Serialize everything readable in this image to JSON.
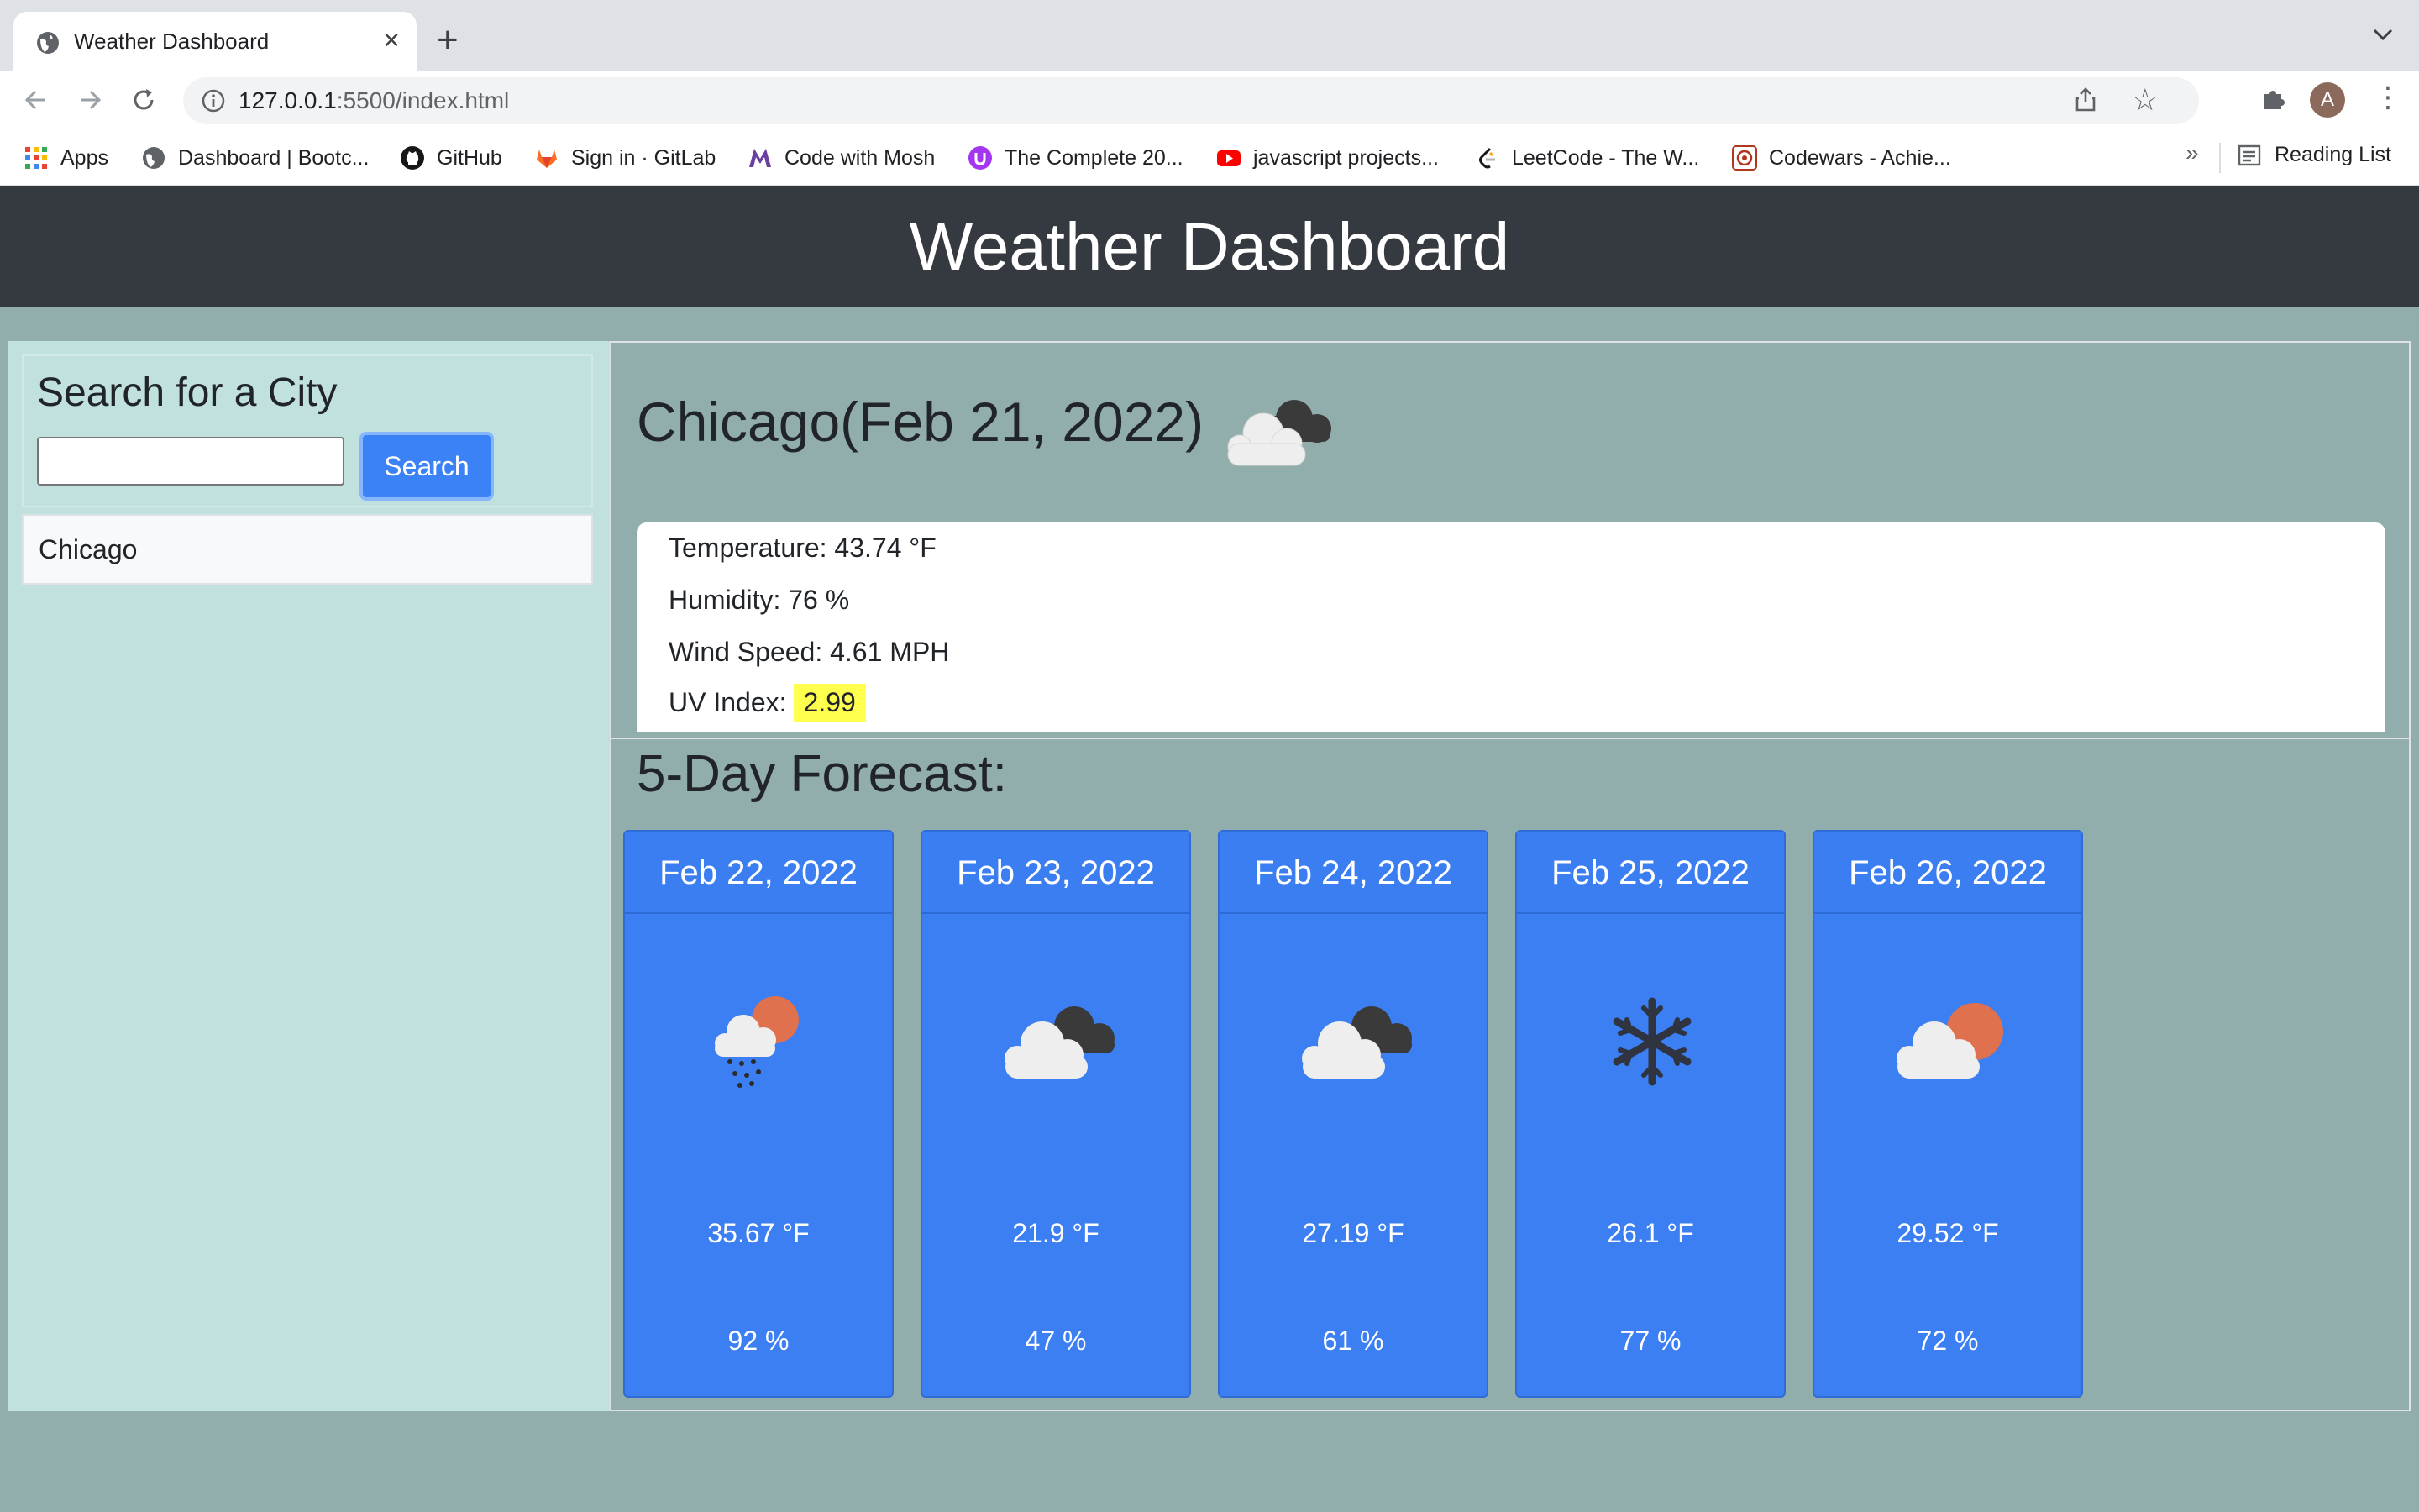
{
  "browser": {
    "tab_title": "Weather Dashboard",
    "url_host": "127.0.0.1",
    "url_rest": ":5500/index.html",
    "profile_initial": "A",
    "bookmarks": [
      {
        "label": "Apps",
        "icon": "apps-grid-icon"
      },
      {
        "label": "Dashboard | Bootc...",
        "icon": "globe-icon"
      },
      {
        "label": "GitHub",
        "icon": "github-icon"
      },
      {
        "label": "Sign in · GitLab",
        "icon": "gitlab-icon"
      },
      {
        "label": "Code with Mosh",
        "icon": "mosh-icon"
      },
      {
        "label": "The Complete 20...",
        "icon": "udemy-icon"
      },
      {
        "label": "javascript projects...",
        "icon": "youtube-icon"
      },
      {
        "label": "LeetCode - The W...",
        "icon": "leetcode-icon"
      },
      {
        "label": "Codewars - Achie...",
        "icon": "codewars-icon"
      }
    ],
    "more_label": "»",
    "reading_list": "Reading List"
  },
  "header": {
    "title": "Weather Dashboard"
  },
  "sidebar": {
    "heading": "Search for a City",
    "search_value": "",
    "search_button": "Search",
    "history": [
      "Chicago"
    ]
  },
  "current": {
    "title": "Chicago(Feb 21, 2022)",
    "icon": "broken-clouds-icon",
    "temperature": "Temperature: 43.74 °F",
    "humidity": "Humidity: 76 %",
    "wind": "Wind Speed: 4.61 MPH",
    "uv_label": "UV Index:",
    "uv_value": "2.99",
    "uv_color": "#ffff4d"
  },
  "forecast": {
    "title": "5-Day Forecast:",
    "days": [
      {
        "date": "Feb 22, 2022",
        "icon": "rain-sun-icon",
        "temp": "35.67 °F",
        "humidity": "92 %"
      },
      {
        "date": "Feb 23, 2022",
        "icon": "broken-clouds-icon",
        "temp": "21.9 °F",
        "humidity": "47 %"
      },
      {
        "date": "Feb 24, 2022",
        "icon": "broken-clouds-icon",
        "temp": "27.19 °F",
        "humidity": "61 %"
      },
      {
        "date": "Feb 25, 2022",
        "icon": "snowflake-icon",
        "temp": "26.1 °F",
        "humidity": "77 %"
      },
      {
        "date": "Feb 26, 2022",
        "icon": "partly-sunny-icon",
        "temp": "29.52 °F",
        "humidity": "72 %"
      }
    ]
  },
  "colors": {
    "header_bg": "#343a40",
    "card_blue": "#3b7ff2",
    "sidebar_bg": "#c0e1dd",
    "page_bg": "#91aead"
  }
}
